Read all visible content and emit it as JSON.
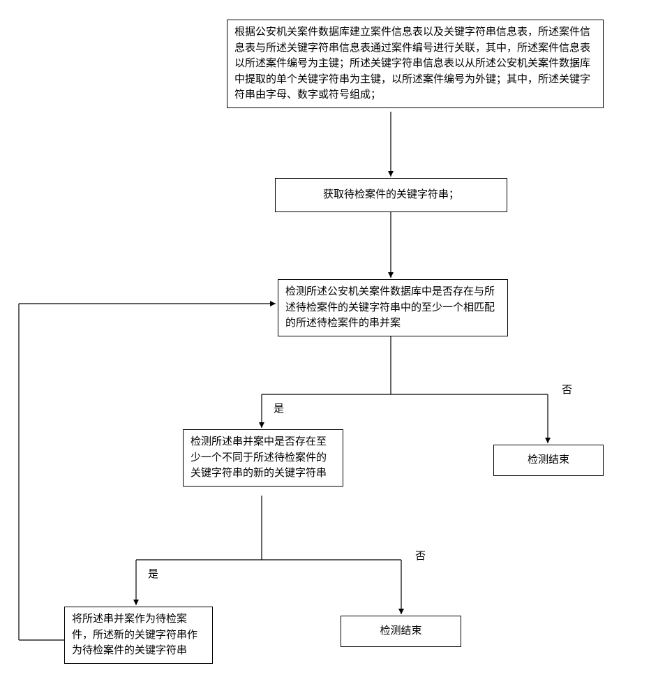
{
  "flow": {
    "step1": "根据公安机关案件数据库建立案件信息表以及关键字符串信息表，所述案件信息表与所述关键字符串信息表通过案件编号进行关联，其中，所述案件信息表以所述案件编号为主键；所述关键字符串信息表以从所述公安机关案件数据库中提取的单个关键字符串为主键，以所述案件编号为外键；其中，所述关键字符串由字母、数字或符号组成；",
    "step2": "获取待检案件的关键字符串；",
    "step3": "检测所述公安机关案件数据库中是否存在与所述待检案件的关键字符串中的至少一个相匹配的所述待检案件的串并案",
    "step4": "检测所述串并案中是否存在至少一个不同于所述待检案件的关键字符串的新的关键字符串",
    "end1": "检测结束",
    "end2": "检测结束",
    "step5": "将所述串并案作为待检案件，所述新的关键字符串作为待检案件的关键字符串",
    "labels": {
      "yes1": "是",
      "no1": "否",
      "yes2": "是",
      "no2": "否"
    }
  }
}
